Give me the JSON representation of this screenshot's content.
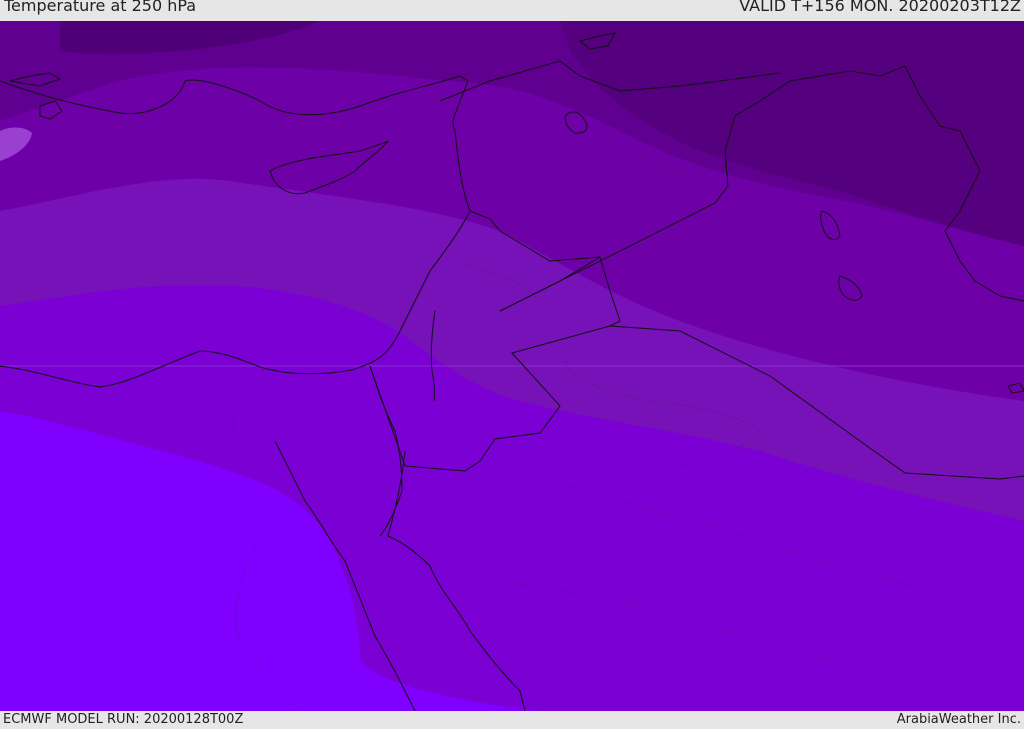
{
  "header": {
    "title": "Temperature at 250 hPa",
    "valid": "VALID T+156 MON. 20200203T12Z"
  },
  "footer": {
    "model_run": "ECMWF MODEL RUN: 20200128T00Z",
    "credit": "ArabiaWeather Inc."
  },
  "map": {
    "variable": "temperature",
    "level": "250 hPa",
    "band_colors": [
      "#4f0078",
      "#5f0090",
      "#6d00a6",
      "#7711b8",
      "#7b00d4",
      "#7f00ff"
    ]
  }
}
